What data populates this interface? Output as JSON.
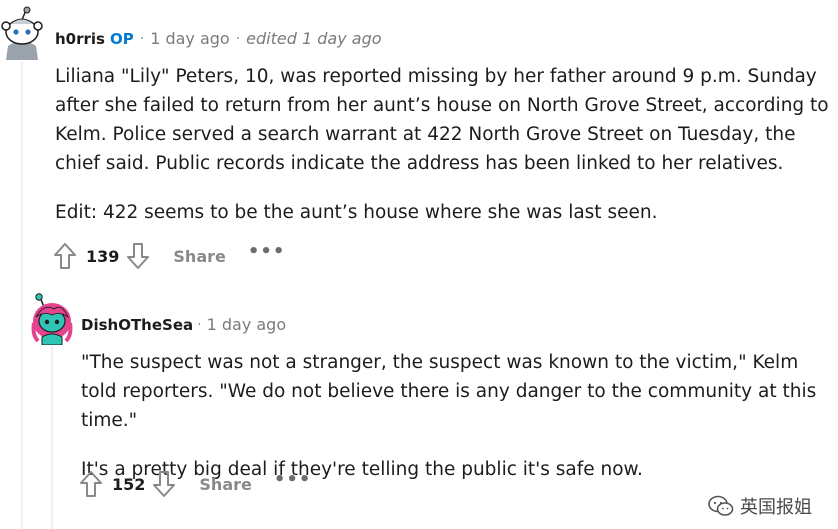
{
  "comments": [
    {
      "author": "h0rris",
      "badge": "OP",
      "separator": "·",
      "time": "1 day ago",
      "edited": "edited 1 day ago",
      "paragraphs": [
        "Liliana \"Lily\" Peters, 10, was reported missing by her father around 9 p.m. Sunday after she failed to return from her aunt’s house on North Grove Street, according to Kelm. Police served a search warrant at 422 North Grove Street on Tuesday, the chief said. Public records indicate the address has been linked to her relatives.",
        "Edit: 422 seems to be the aunt’s house where she was last seen."
      ],
      "score": "139",
      "share_label": "Share",
      "more_label": "•••"
    },
    {
      "author": "DishOTheSea",
      "separator": "·",
      "time": "1 day ago",
      "paragraphs": [
        "\"The suspect was not a stranger, the suspect was known to the victim,\" Kelm told reporters. \"We do not believe there is any danger to the community at this time.\"",
        "It's a pretty big deal if they're telling the public it's safe now."
      ],
      "score": "152",
      "share_label": "Share",
      "more_label": "•••"
    }
  ],
  "watermark": {
    "text": "英国报姐"
  },
  "colors": {
    "op_badge": "#0079d3",
    "meta_gray": "#787c7e",
    "thread_line": "#edeff1"
  }
}
